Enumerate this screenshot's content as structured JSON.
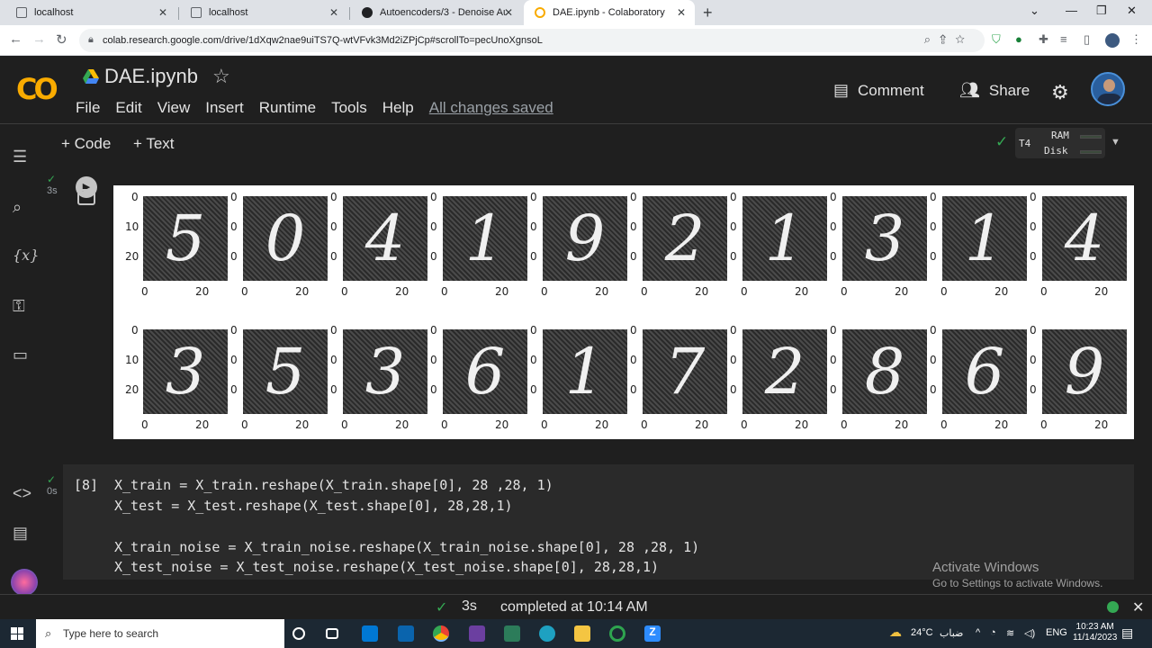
{
  "browser": {
    "tabs": [
      {
        "title": "localhost",
        "active": false
      },
      {
        "title": "localhost",
        "active": false
      },
      {
        "title": "Autoencoders/3 - Denoise Auto",
        "active": false
      },
      {
        "title": "DAE.ipynb - Colaboratory",
        "active": true
      }
    ],
    "url": "colab.research.google.com/drive/1dXqw2nae9uiTS7Q-wtVFvk3Md2iZPjCp#scrollTo=pecUnoXgnsoL"
  },
  "colab": {
    "logo": "CO",
    "notebook_title": "DAE.ipynb",
    "menu": [
      "File",
      "Edit",
      "View",
      "Insert",
      "Runtime",
      "Tools",
      "Help"
    ],
    "save_status": "All changes saved",
    "comment_label": "Comment",
    "share_label": "Share",
    "toolbar": {
      "add_code": "+ Code",
      "add_text": "+ Text"
    },
    "runtime": {
      "accelerator": "T4",
      "ram_label": "RAM",
      "disk_label": "Disk"
    }
  },
  "output_cell": {
    "exec_time": "3s",
    "figure": {
      "row1_digits": [
        "5",
        "0",
        "4",
        "1",
        "9",
        "2",
        "1",
        "3",
        "1",
        "4"
      ],
      "row2_digits": [
        "3",
        "5",
        "3",
        "6",
        "1",
        "7",
        "2",
        "8",
        "6",
        "9"
      ],
      "y_ticks": [
        "0",
        "10",
        "20"
      ],
      "x_ticks": [
        "0",
        "20"
      ]
    }
  },
  "code_cell": {
    "exec_count": "[8]",
    "exec_time": "0s",
    "lines": [
      "X_train = X_train.reshape(X_train.shape[0], 28 ,28, 1)",
      "X_test = X_test.reshape(X_test.shape[0], 28,28,1)",
      "",
      "X_train_noise = X_train_noise.reshape(X_train_noise.shape[0], 28 ,28, 1)",
      "X_test_noise = X_test_noise.reshape(X_test_noise.shape[0], 28,28,1)"
    ]
  },
  "watermark": {
    "title": "Activate Windows",
    "subtitle": "Go to Settings to activate Windows."
  },
  "status": {
    "time": "3s",
    "message": "completed at 10:14 AM"
  },
  "taskbar": {
    "search_placeholder": "Type here to search",
    "weather": "24°C",
    "weather_text": "ضباب",
    "lang": "ENG",
    "time": "10:23 AM",
    "date": "11/14/2023"
  }
}
